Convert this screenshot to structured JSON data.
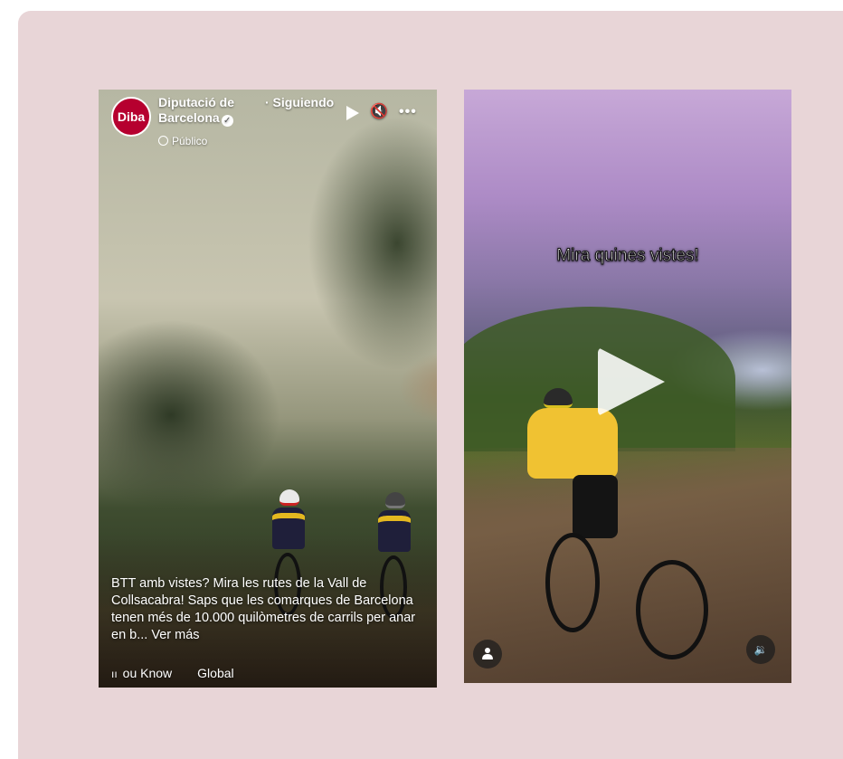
{
  "left_reel": {
    "avatar_text": "Diba",
    "page_name_line1": "Diputació de",
    "page_name_line2": "Barcelona",
    "verified_mark": "✓",
    "following": "· Siguiendo",
    "audience": "Público",
    "mute_glyph": "🔇",
    "more_glyph": "•••",
    "caption": "BTT amb vistes? Mira les rutes de la Vall de Collsacabra! Saps que les comarques de Barcelona tenen més de 10.000 quilòmetres de carrils per anar en b...",
    "see_more": "Ver más",
    "audio_wave": "ıı",
    "audio_track": "ou Know",
    "audio_track_2": "Global"
  },
  "right_video": {
    "overlay_text": "Mira quines vistes!",
    "sound_glyph": "🔉"
  },
  "colors": {
    "background": "#e8d5d7",
    "brand_red": "#b6002f"
  },
  "icons": [
    "globe-icon",
    "play-icon",
    "mute-icon",
    "more-icon",
    "verified-icon",
    "audio-wave-icon",
    "play-button-icon",
    "person-icon",
    "sound-icon"
  ]
}
